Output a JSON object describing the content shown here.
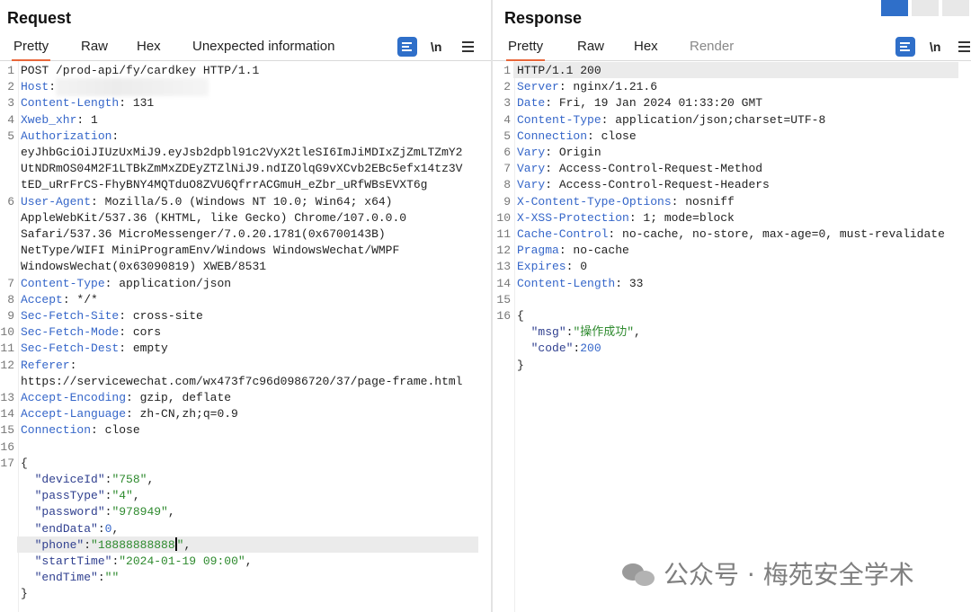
{
  "request": {
    "title": "Request",
    "tabs": [
      "Pretty",
      "Raw",
      "Hex",
      "Unexpected information"
    ],
    "lines": [
      {
        "n": "1",
        "segs": [
          [
            "v",
            "POST /prod-api/fy/cardkey HTTP/1.1"
          ]
        ]
      },
      {
        "n": "2",
        "segs": [
          [
            "k",
            "Host"
          ],
          [
            "v",
            ":"
          ]
        ]
      },
      {
        "n": "3",
        "segs": [
          [
            "k",
            "Content-Length"
          ],
          [
            "v",
            ": 131"
          ]
        ]
      },
      {
        "n": "4",
        "segs": [
          [
            "k",
            "Xweb_xhr"
          ],
          [
            "v",
            ": 1"
          ]
        ]
      },
      {
        "n": "5",
        "segs": [
          [
            "k",
            "Authorization"
          ],
          [
            "v",
            ":"
          ]
        ]
      },
      {
        "n": "",
        "segs": [
          [
            "v",
            "eyJhbGciOiJIUzUxMiJ9.eyJsb2dpbl91c2VyX2tleSI6ImJiMDIxZjZmLTZmY2"
          ]
        ]
      },
      {
        "n": "",
        "segs": [
          [
            "v",
            "UtNDRmOS04M2F1LTBkZmMxZDEyZTZlNiJ9.ndIZOlqG9vXCvb2EBc5efx14tz3V"
          ]
        ]
      },
      {
        "n": "",
        "segs": [
          [
            "v",
            "tED_uRrFrCS-FhyBNY4MQTduO8ZVU6QfrrACGmuH_eZbr_uRfWBsEVXT6g"
          ]
        ]
      },
      {
        "n": "6",
        "segs": [
          [
            "k",
            "User-Agent"
          ],
          [
            "v",
            ": Mozilla/5.0 (Windows NT 10.0; Win64; x64)"
          ]
        ]
      },
      {
        "n": "",
        "segs": [
          [
            "v",
            "AppleWebKit/537.36 (KHTML, like Gecko) Chrome/107.0.0.0"
          ]
        ]
      },
      {
        "n": "",
        "segs": [
          [
            "v",
            "Safari/537.36 MicroMessenger/7.0.20.1781(0x6700143B)"
          ]
        ]
      },
      {
        "n": "",
        "segs": [
          [
            "v",
            "NetType/WIFI MiniProgramEnv/Windows WindowsWechat/WMPF"
          ]
        ]
      },
      {
        "n": "",
        "segs": [
          [
            "v",
            "WindowsWechat(0x63090819) XWEB/8531"
          ]
        ]
      },
      {
        "n": "7",
        "segs": [
          [
            "k",
            "Content-Type"
          ],
          [
            "v",
            ": application/json"
          ]
        ]
      },
      {
        "n": "8",
        "segs": [
          [
            "k",
            "Accept"
          ],
          [
            "v",
            ": */*"
          ]
        ]
      },
      {
        "n": "9",
        "segs": [
          [
            "k",
            "Sec-Fetch-Site"
          ],
          [
            "v",
            ": cross-site"
          ]
        ]
      },
      {
        "n": "10",
        "segs": [
          [
            "k",
            "Sec-Fetch-Mode"
          ],
          [
            "v",
            ": cors"
          ]
        ]
      },
      {
        "n": "11",
        "segs": [
          [
            "k",
            "Sec-Fetch-Dest"
          ],
          [
            "v",
            ": empty"
          ]
        ]
      },
      {
        "n": "12",
        "segs": [
          [
            "k",
            "Referer"
          ],
          [
            "v",
            ":"
          ]
        ]
      },
      {
        "n": "",
        "segs": [
          [
            "v",
            "https://servicewechat.com/wx473f7c96d0986720/37/page-frame.html"
          ]
        ]
      },
      {
        "n": "13",
        "segs": [
          [
            "k",
            "Accept-Encoding"
          ],
          [
            "v",
            ": gzip, deflate"
          ]
        ]
      },
      {
        "n": "14",
        "segs": [
          [
            "k",
            "Accept-Language"
          ],
          [
            "v",
            ": zh-CN,zh;q=0.9"
          ]
        ]
      },
      {
        "n": "15",
        "segs": [
          [
            "k",
            "Connection"
          ],
          [
            "v",
            ": close"
          ]
        ]
      },
      {
        "n": "16",
        "segs": []
      },
      {
        "n": "17",
        "segs": [
          [
            "v",
            "{"
          ]
        ]
      },
      {
        "n": "",
        "segs": [
          [
            "v",
            "  "
          ],
          [
            "jk",
            "\"deviceId\""
          ],
          [
            "v",
            ":"
          ],
          [
            "s",
            "\"758\""
          ],
          [
            "v",
            ","
          ]
        ]
      },
      {
        "n": "",
        "segs": [
          [
            "v",
            "  "
          ],
          [
            "jk",
            "\"passType\""
          ],
          [
            "v",
            ":"
          ],
          [
            "s",
            "\"4\""
          ],
          [
            "v",
            ","
          ]
        ]
      },
      {
        "n": "",
        "segs": [
          [
            "v",
            "  "
          ],
          [
            "jk",
            "\"password\""
          ],
          [
            "v",
            ":"
          ],
          [
            "s",
            "\"978949\""
          ],
          [
            "v",
            ","
          ]
        ]
      },
      {
        "n": "",
        "segs": [
          [
            "v",
            "  "
          ],
          [
            "jk",
            "\"endData\""
          ],
          [
            "v",
            ":"
          ],
          [
            "n",
            "0"
          ],
          [
            "v",
            ","
          ]
        ]
      },
      {
        "n": "",
        "hl": true,
        "segs": [
          [
            "v",
            "  "
          ],
          [
            "jk",
            "\"phone\""
          ],
          [
            "v",
            ":"
          ],
          [
            "s",
            "\"18888888888"
          ],
          [
            "cursor",
            ""
          ],
          [
            "s",
            "\""
          ],
          [
            "v",
            ","
          ]
        ]
      },
      {
        "n": "",
        "segs": [
          [
            "v",
            "  "
          ],
          [
            "jk",
            "\"startTime\""
          ],
          [
            "v",
            ":"
          ],
          [
            "s",
            "\"2024-01-19 09:00\""
          ],
          [
            "v",
            ","
          ]
        ]
      },
      {
        "n": "",
        "segs": [
          [
            "v",
            "  "
          ],
          [
            "jk",
            "\"endTime\""
          ],
          [
            "v",
            ":"
          ],
          [
            "s",
            "\"\""
          ]
        ]
      },
      {
        "n": "",
        "segs": [
          [
            "v",
            "}"
          ]
        ]
      }
    ]
  },
  "response": {
    "title": "Response",
    "tabs": [
      "Pretty",
      "Raw",
      "Hex",
      "Render"
    ],
    "lines": [
      {
        "n": "1",
        "hl": true,
        "segs": [
          [
            "v",
            "HTTP/1.1 200"
          ]
        ]
      },
      {
        "n": "2",
        "segs": [
          [
            "k",
            "Server"
          ],
          [
            "v",
            ": nginx/1.21.6"
          ]
        ]
      },
      {
        "n": "3",
        "segs": [
          [
            "k",
            "Date"
          ],
          [
            "v",
            ": Fri, 19 Jan 2024 01:33:20 GMT"
          ]
        ]
      },
      {
        "n": "4",
        "segs": [
          [
            "k",
            "Content-Type"
          ],
          [
            "v",
            ": application/json;charset=UTF-8"
          ]
        ]
      },
      {
        "n": "5",
        "segs": [
          [
            "k",
            "Connection"
          ],
          [
            "v",
            ": close"
          ]
        ]
      },
      {
        "n": "6",
        "segs": [
          [
            "k",
            "Vary"
          ],
          [
            "v",
            ": Origin"
          ]
        ]
      },
      {
        "n": "7",
        "segs": [
          [
            "k",
            "Vary"
          ],
          [
            "v",
            ": Access-Control-Request-Method"
          ]
        ]
      },
      {
        "n": "8",
        "segs": [
          [
            "k",
            "Vary"
          ],
          [
            "v",
            ": Access-Control-Request-Headers"
          ]
        ]
      },
      {
        "n": "9",
        "segs": [
          [
            "k",
            "X-Content-Type-Options"
          ],
          [
            "v",
            ": nosniff"
          ]
        ]
      },
      {
        "n": "10",
        "segs": [
          [
            "k",
            "X-XSS-Protection"
          ],
          [
            "v",
            ": 1; mode=block"
          ]
        ]
      },
      {
        "n": "11",
        "segs": [
          [
            "k",
            "Cache-Control"
          ],
          [
            "v",
            ": no-cache, no-store, max-age=0, must-revalidate"
          ]
        ]
      },
      {
        "n": "12",
        "segs": [
          [
            "k",
            "Pragma"
          ],
          [
            "v",
            ": no-cache"
          ]
        ]
      },
      {
        "n": "13",
        "segs": [
          [
            "k",
            "Expires"
          ],
          [
            "v",
            ": 0"
          ]
        ]
      },
      {
        "n": "14",
        "segs": [
          [
            "k",
            "Content-Length"
          ],
          [
            "v",
            ": 33"
          ]
        ]
      },
      {
        "n": "15",
        "segs": []
      },
      {
        "n": "16",
        "segs": [
          [
            "v",
            "{"
          ]
        ]
      },
      {
        "n": "",
        "segs": [
          [
            "v",
            "  "
          ],
          [
            "jk",
            "\"msg\""
          ],
          [
            "v",
            ":"
          ],
          [
            "s",
            "\"操作成功\""
          ],
          [
            "v",
            ","
          ]
        ]
      },
      {
        "n": "",
        "segs": [
          [
            "v",
            "  "
          ],
          [
            "jk",
            "\"code\""
          ],
          [
            "v",
            ":"
          ],
          [
            "n",
            "200"
          ]
        ]
      },
      {
        "n": "",
        "segs": [
          [
            "v",
            "}"
          ]
        ]
      }
    ]
  },
  "toolbar": {
    "newline_label": "\\n"
  },
  "watermark": {
    "text": "公众号 · 梅苑安全学术"
  },
  "colors": {
    "accent": "#e8673a",
    "key": "#3566c9",
    "string": "#2e8a2e",
    "icon_bg": "#2f6fc9"
  },
  "icons": [
    "format-icon",
    "newline-icon",
    "menu-icon",
    "wechat-logo-icon"
  ]
}
